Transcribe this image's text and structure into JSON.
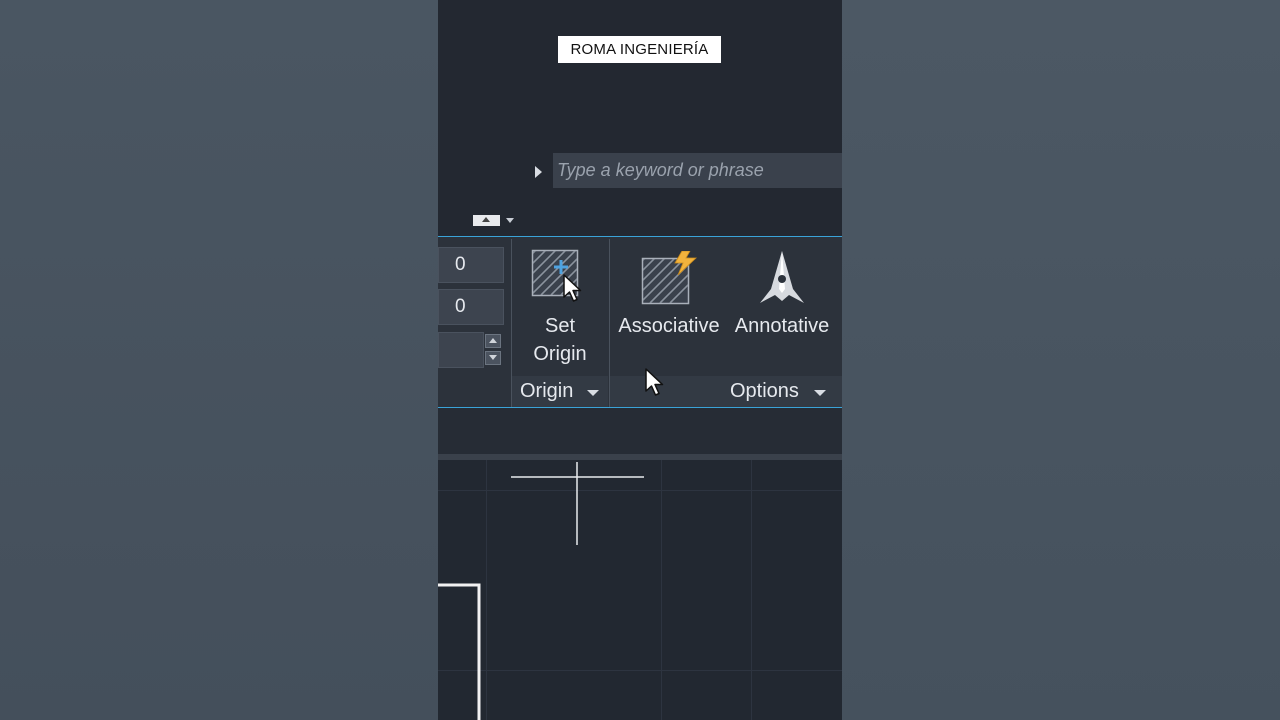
{
  "watermark": {
    "text": "ROMA INGENIERÍA"
  },
  "search": {
    "placeholder": "Type a keyword or phrase"
  },
  "ribbon": {
    "fields": [
      {
        "value": "0"
      },
      {
        "value": "0"
      },
      {
        "value": ""
      }
    ],
    "origin_panel": {
      "set_origin_label_line1": "Set",
      "set_origin_label_line2": "Origin",
      "title": "Origin"
    },
    "options_panel": {
      "associative_label": "Associative",
      "annotative_label": "Annotative",
      "title": "Options"
    }
  },
  "icons": {
    "expand": "triangle-right-icon",
    "set_origin": "set-origin-hatch-icon",
    "associative": "associative-hatch-icon",
    "annotative": "annotative-icon",
    "cursor": "mouse-pointer-icon"
  },
  "colors": {
    "accent": "#3aa3d8",
    "background": "#232831",
    "plus": "#4fa3e0",
    "lightning": "#f2b33d"
  }
}
